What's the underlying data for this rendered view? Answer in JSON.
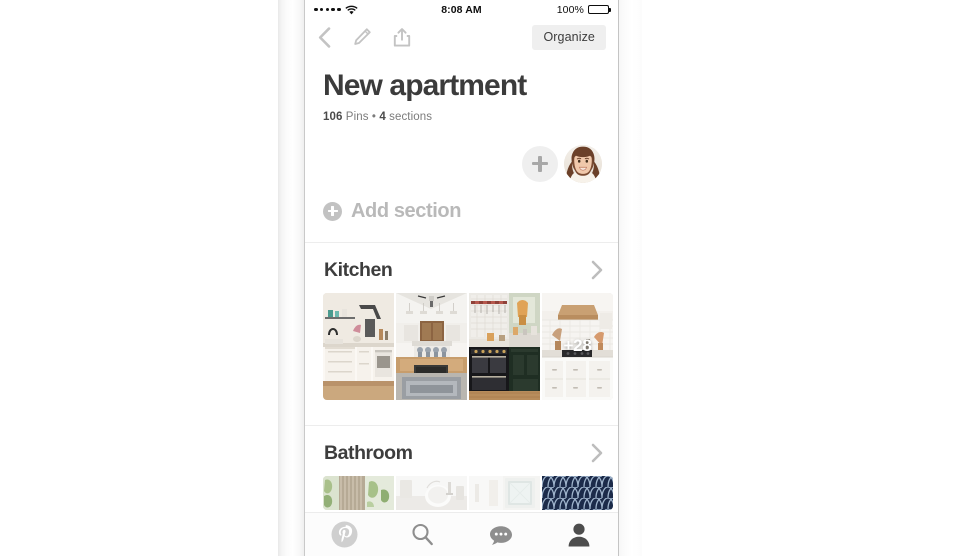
{
  "status_bar": {
    "carrier_dots": 5,
    "wifi_icon": "wifi-icon",
    "time": "8:08 AM",
    "battery_percent": "100%",
    "battery_icon": "battery-full-icon"
  },
  "nav_bar": {
    "back_icon": "chevron-left-icon",
    "edit_icon": "pencil-icon",
    "share_icon": "share-upload-icon",
    "organize_label": "Organize"
  },
  "board": {
    "title": "New apartment",
    "pin_count": "106",
    "pins_word": "Pins",
    "separator": "•",
    "section_count": "4",
    "sections_word": "sections",
    "meta_full": "106 Pins • 4 sections"
  },
  "collaborators": {
    "add_icon": "plus-icon",
    "add_label": "Add collaborator",
    "avatar_label": "avatar"
  },
  "add_section": {
    "icon": "circle-plus-icon",
    "label": "Add section"
  },
  "sections": [
    {
      "name": "Kitchen",
      "chevron_icon": "chevron-right-icon",
      "overflow_label": "+28",
      "thumbnails": [
        {
          "alt": "white-kitchen-with-range-hood",
          "tone": "#efe9e2"
        },
        {
          "alt": "farmhouse-kitchen-island",
          "tone": "#e3e4e2"
        },
        {
          "alt": "dark-green-kitchen-with-range",
          "tone": "#cfd3cd"
        },
        {
          "alt": "white-kitchen-wood-hood",
          "tone": "#efece7"
        }
      ]
    },
    {
      "name": "Bathroom",
      "chevron_icon": "chevron-right-icon",
      "overflow_label": "",
      "thumbnails": [
        {
          "alt": "bathroom-wood-vanity",
          "tone": "#d8d4cb"
        },
        {
          "alt": "white-bathroom-sink",
          "tone": "#f0f0ee"
        },
        {
          "alt": "bright-bathroom-mirror",
          "tone": "#f2f2f0"
        },
        {
          "alt": "navy-scallop-tile",
          "tone": "#1c2b4a"
        }
      ]
    }
  ],
  "tab_bar": {
    "items": [
      {
        "icon": "pinterest-icon",
        "label": "Home",
        "active": false
      },
      {
        "icon": "search-icon",
        "label": "Search",
        "active": false
      },
      {
        "icon": "chat-bubble-icon",
        "label": "Messages",
        "active": false
      },
      {
        "icon": "person-icon",
        "label": "Profile",
        "active": true
      }
    ]
  },
  "colors": {
    "text_dark": "#3b3b3b",
    "text_muted": "#7b7b7b",
    "icon_light": "#c3c3c3",
    "chip_bg": "#efefef",
    "accent_navy": "#1c2b4a"
  }
}
